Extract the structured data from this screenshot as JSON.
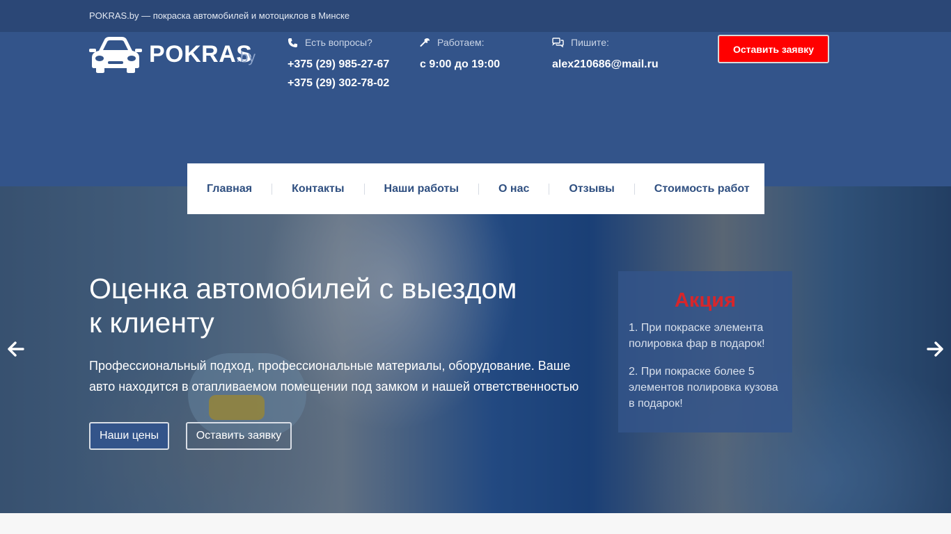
{
  "topbar": {
    "tagline": "POKRAS.by — покраска автомобилей и мотоциклов в Минске"
  },
  "logo": {
    "name": "POKRAS",
    "ext": ".by"
  },
  "contacts": {
    "questions": {
      "label": "Есть вопросы?",
      "phones": [
        "+375 (29) 985-27-67",
        "+375 (29) 302-78-02"
      ]
    },
    "hours": {
      "label": "Работаем:",
      "value": "с 9:00 до 19:00"
    },
    "email": {
      "label": "Пишите:",
      "value": "alex210686@mail.ru"
    }
  },
  "header_button": "Оставить заявку",
  "nav": {
    "items": [
      "Главная",
      "Контакты",
      "Наши работы",
      "О нас",
      "Отзывы",
      "Стоимость работ"
    ]
  },
  "hero": {
    "title": "Оценка автомобилей с выездом к клиенту",
    "text": "Профессиональный подход, профессиональные материалы, оборудование. Ваше авто находится в отапливаемом помещении под замком и нашей ответственностью",
    "btn_prices": "Наши цены",
    "btn_order": "Оставить заявку"
  },
  "promo": {
    "title": "Акция",
    "items": [
      "1. При покраске элемента полировка фар в подарок!",
      "2. При покраске более 5 элементов полировка кузова в подарок!"
    ]
  },
  "colors": {
    "brand_blue": "#33548a",
    "topbar": "#2b4776",
    "accent_red": "#ff0000",
    "promo_title": "#d7262b"
  },
  "icons": [
    "car-logo-icon",
    "phone-icon",
    "wrench-icon",
    "chat-icon",
    "arrow-left-icon",
    "arrow-right-icon"
  ]
}
